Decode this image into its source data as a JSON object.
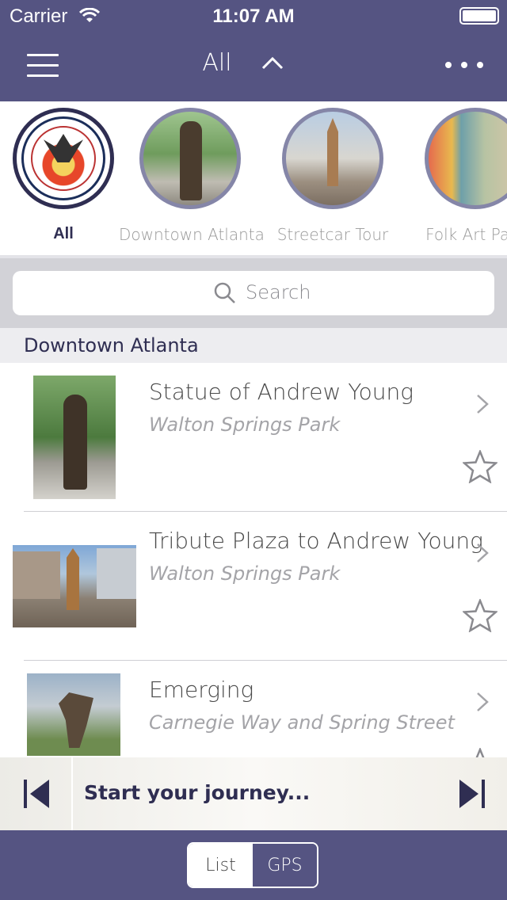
{
  "status_bar": {
    "carrier": "Carrier",
    "time": "11:07 AM"
  },
  "nav": {
    "title": "All"
  },
  "categories": [
    {
      "label": "All",
      "active": true,
      "icon": "city-seal"
    },
    {
      "label": "Downtown Atlanta",
      "active": false,
      "icon": "statue-photo"
    },
    {
      "label": "Streetcar Tour",
      "active": false,
      "icon": "plaza-photo"
    },
    {
      "label": "Folk Art Park",
      "active": false,
      "icon": "folk-art-photo"
    }
  ],
  "search": {
    "placeholder": "Search"
  },
  "section": {
    "title": "Downtown Atlanta"
  },
  "items": [
    {
      "title": "Statue of Andrew Young",
      "subtitle": "Walton Springs Park"
    },
    {
      "title": "Tribute Plaza to Andrew Young",
      "subtitle": "Walton Springs Park"
    },
    {
      "title": "Emerging",
      "subtitle": "Carnegie Way and Spring Street"
    }
  ],
  "player": {
    "text": "Start your journey..."
  },
  "view_toggle": {
    "list": "List",
    "gps": "GPS",
    "selected": "List"
  },
  "colors": {
    "brand": "#555482",
    "accent_dark": "#2f2e52",
    "ring": "#8586a8"
  }
}
